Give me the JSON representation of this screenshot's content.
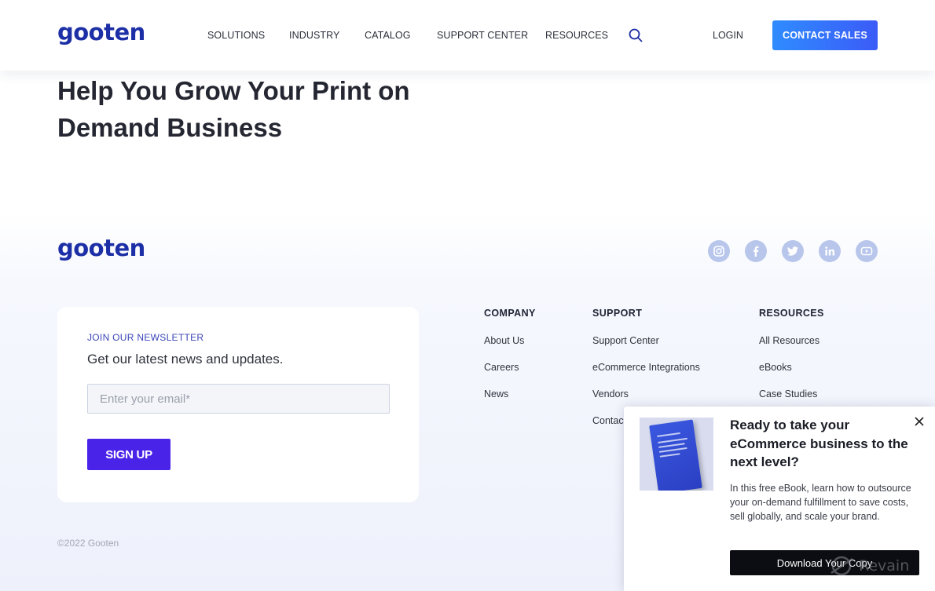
{
  "header": {
    "logo": "gooten",
    "nav": [
      "SOLUTIONS",
      "INDUSTRY",
      "CATALOG",
      "SUPPORT CENTER",
      "RESOURCES"
    ],
    "search_icon": "search-icon",
    "login": "LOGIN",
    "cta": "CONTACT SALES"
  },
  "hero": {
    "title": "Help You Grow Your Print on Demand Business"
  },
  "footer": {
    "logo": "gooten",
    "social": [
      "instagram-icon",
      "facebook-icon",
      "twitter-icon",
      "linkedin-icon",
      "youtube-icon"
    ],
    "newsletter": {
      "kicker": "JOIN OUR NEWSLETTER",
      "text": "Get our latest news and updates.",
      "placeholder": "Enter your email*",
      "button": "SIGN UP"
    },
    "columns": [
      {
        "heading": "COMPANY",
        "links": [
          "About Us",
          "Careers",
          "News"
        ]
      },
      {
        "heading": "SUPPORT",
        "links": [
          "Support Center",
          "eCommerce Integrations",
          "Vendors",
          "Contac"
        ]
      },
      {
        "heading": "RESOURCES",
        "links": [
          "All Resources",
          "eBooks",
          "Case Studies"
        ]
      }
    ],
    "copyright": "©2022 Gooten"
  },
  "popup": {
    "title": "Ready to take your eCommerce business to the next level?",
    "body": "In this free eBook, learn how to outsource your on-demand fulfillment to save costs, sell globally, and scale your brand.",
    "button": "Download Your Copy"
  },
  "watermark": "Revain",
  "colors": {
    "brand": "#1d2fa6",
    "cta_gradient_start": "#2f8cff",
    "cta_gradient_end": "#3b5bf7",
    "signup": "#4a23e8",
    "social": "#b8c6ec"
  }
}
